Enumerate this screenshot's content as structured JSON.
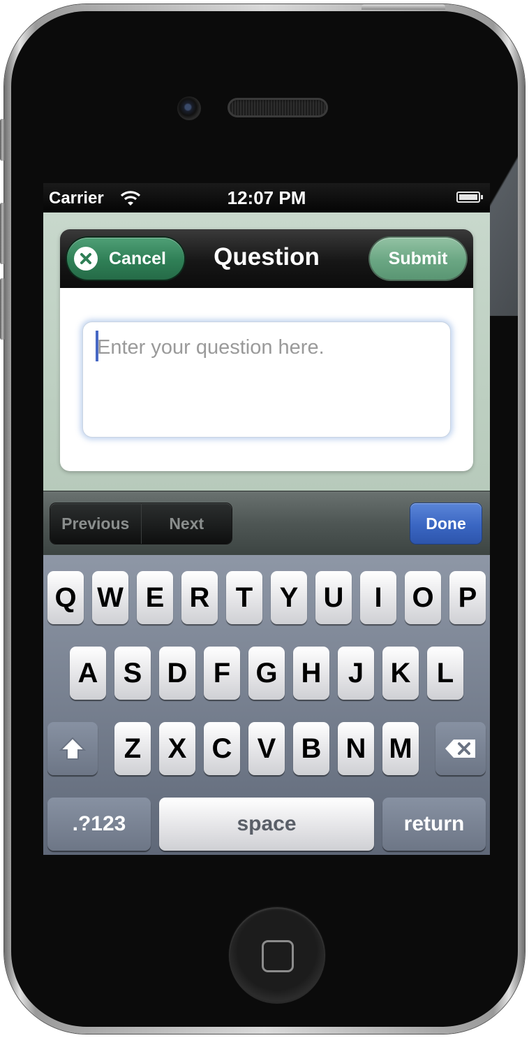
{
  "status_bar": {
    "carrier": "Carrier",
    "time": "12:07 PM"
  },
  "dialog": {
    "title": "Question",
    "cancel_label": "Cancel",
    "submit_label": "Submit",
    "input_placeholder": "Enter your question here."
  },
  "form_toolbar": {
    "previous_label": "Previous",
    "next_label": "Next",
    "done_label": "Done"
  },
  "keyboard": {
    "row1": [
      "Q",
      "W",
      "E",
      "R",
      "T",
      "Y",
      "U",
      "I",
      "O",
      "P"
    ],
    "row2": [
      "A",
      "S",
      "D",
      "F",
      "G",
      "H",
      "J",
      "K",
      "L"
    ],
    "row3": [
      "Z",
      "X",
      "C",
      "V",
      "B",
      "N",
      "M"
    ],
    "numbers_label": ".?123",
    "space_label": "space",
    "return_label": "return"
  }
}
